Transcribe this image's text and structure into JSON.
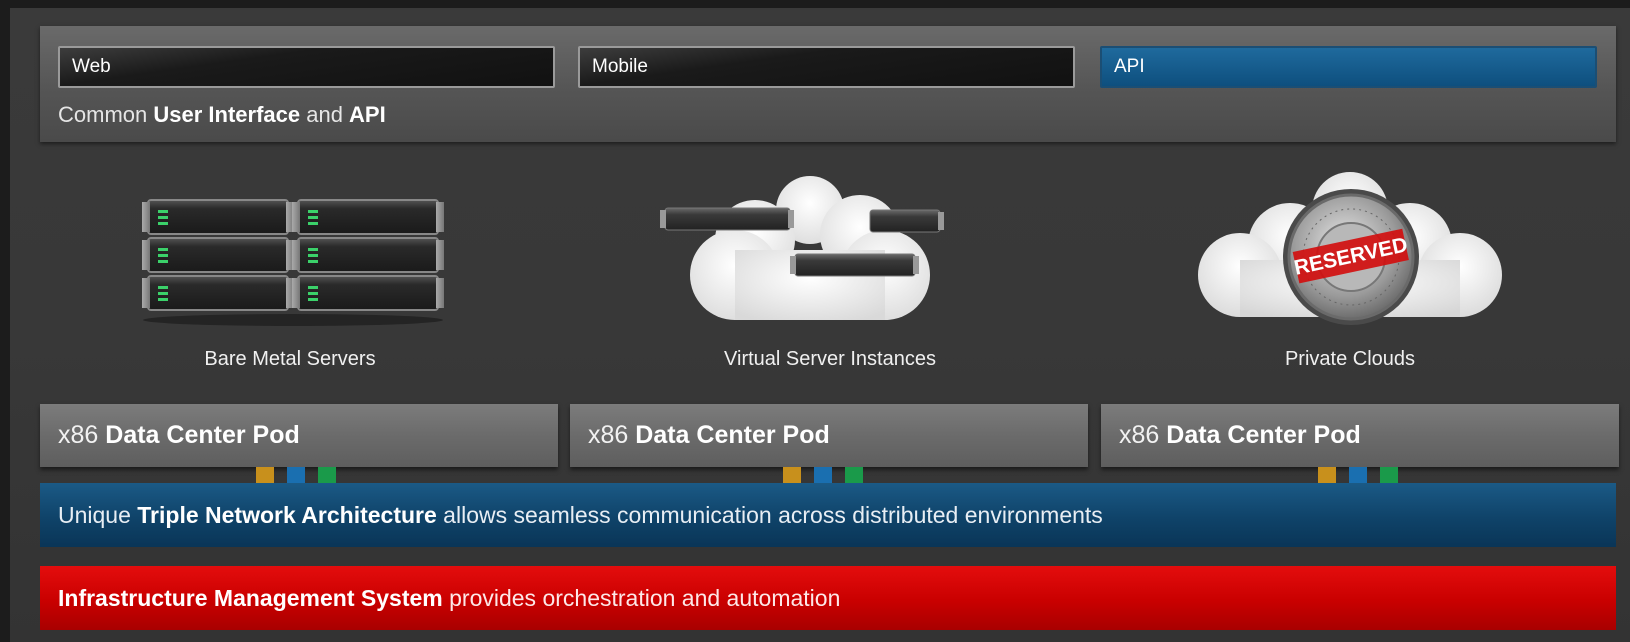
{
  "clients": {
    "web": "Web",
    "mobile": "Mobile",
    "api": "API"
  },
  "ui_caption": {
    "prefix": "Common ",
    "bold1": "User Interface",
    "middle": " and ",
    "bold2": "API"
  },
  "services": {
    "bare_metal": "Bare Metal Servers",
    "virtual": "Virtual Server Instances",
    "private_clouds": "Private Clouds",
    "reserved_stamp": "RESERVED"
  },
  "pods": [
    {
      "prefix": "x86 ",
      "name": "Data Center Pod"
    },
    {
      "prefix": "x86 ",
      "name": "Data Center Pod"
    },
    {
      "prefix": "x86 ",
      "name": "Data Center Pod"
    }
  ],
  "network": {
    "prefix": "Unique ",
    "bold": "Triple Network Architecture",
    "suffix": " allows seamless communication across distributed environments"
  },
  "ims": {
    "bold": "Infrastructure Management System",
    "suffix": " provides orchestration and automation"
  },
  "colors": {
    "api_blue": "#0e4f7e",
    "network_blue": "#0f4369",
    "ims_red": "#c90000",
    "cable_orange": "#c8901c",
    "cable_blue": "#1a6fb0",
    "cable_green": "#1a9a4a"
  }
}
